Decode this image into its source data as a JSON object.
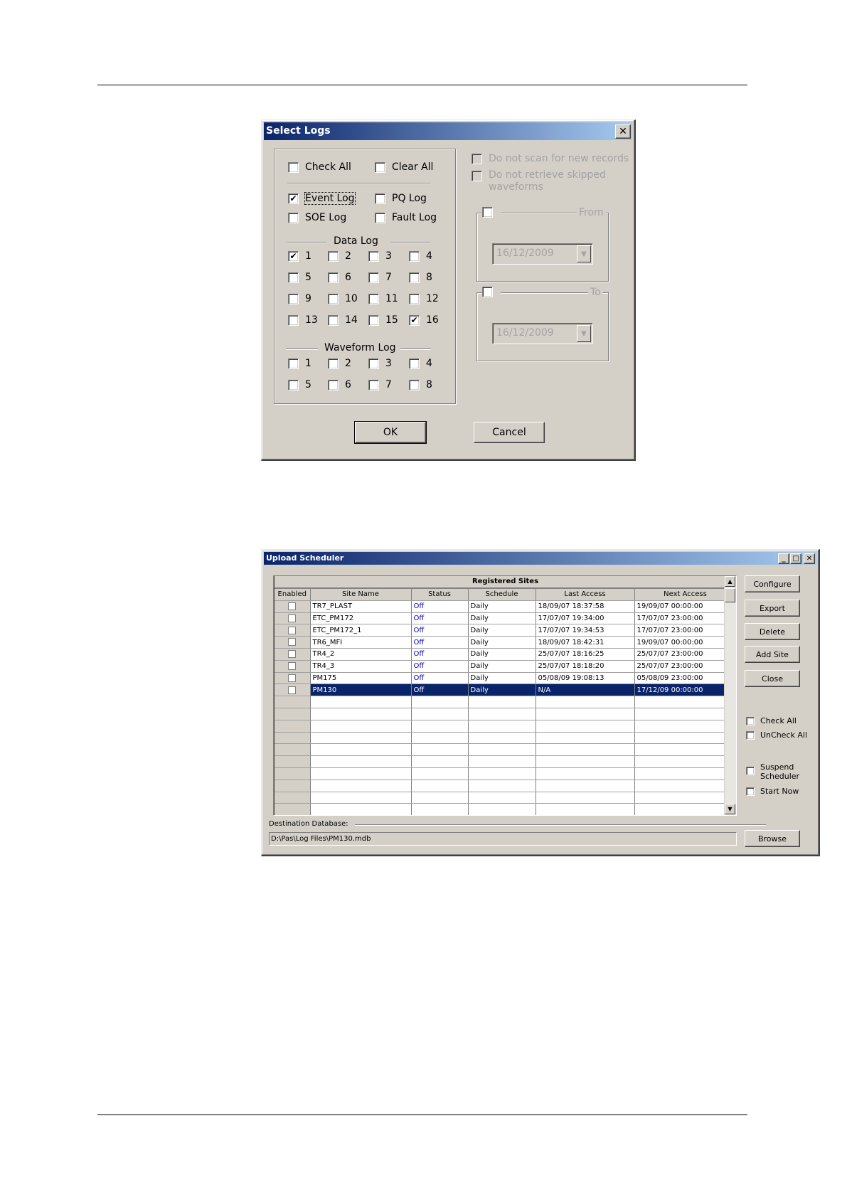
{
  "select_logs": {
    "title": "Select Logs",
    "close_glyph": "✕",
    "check_all": "Check All",
    "clear_all": "Clear All",
    "event_log": "Event Log",
    "pq_log": "PQ Log",
    "soe_log": "SOE Log",
    "fault_log": "Fault Log",
    "data_log_heading": "Data Log",
    "data_log_items": [
      "1",
      "2",
      "3",
      "4",
      "5",
      "6",
      "7",
      "8",
      "9",
      "10",
      "11",
      "12",
      "13",
      "14",
      "15",
      "16"
    ],
    "data_log_checked": [
      "1",
      "16"
    ],
    "waveform_log_heading": "Waveform Log",
    "waveform_items": [
      "1",
      "2",
      "3",
      "4",
      "5",
      "6",
      "7",
      "8"
    ],
    "no_scan": "Do not scan for new records",
    "no_retrieve_1": "Do not retrieve skipped",
    "no_retrieve_2": "waveforms",
    "from_label": "From",
    "from_date": "16/12/2009",
    "to_label": "To",
    "to_date": "16/12/2009",
    "ok": "OK",
    "cancel": "Cancel",
    "combo_arrow": "▼"
  },
  "upload_scheduler": {
    "title": "Upload Scheduler",
    "grid_title": "Registered Sites",
    "columns": [
      "Enabled",
      "Site Name",
      "Status",
      "Schedule",
      "Last Access",
      "Next Access"
    ],
    "rows": [
      {
        "site": "TR7_PLAST",
        "status": "Off",
        "schedule": "Daily",
        "last": "18/09/07 18:37:58",
        "next": "19/09/07 00:00:00"
      },
      {
        "site": "ETC_PM172",
        "status": "Off",
        "schedule": "Daily",
        "last": "17/07/07 19:34:00",
        "next": "17/07/07 23:00:00"
      },
      {
        "site": "ETC_PM172_1",
        "status": "Off",
        "schedule": "Daily",
        "last": "17/07/07 19:34:53",
        "next": "17/07/07 23:00:00"
      },
      {
        "site": "TR6_MFI",
        "status": "Off",
        "schedule": "Daily",
        "last": "18/09/07 18:42:31",
        "next": "19/09/07 00:00:00"
      },
      {
        "site": "TR4_2",
        "status": "Off",
        "schedule": "Daily",
        "last": "25/07/07 18:16:25",
        "next": "25/07/07 23:00:00"
      },
      {
        "site": "TR4_3",
        "status": "Off",
        "schedule": "Daily",
        "last": "25/07/07 18:18:20",
        "next": "25/07/07 23:00:00"
      },
      {
        "site": "PM175",
        "status": "Off",
        "schedule": "Daily",
        "last": "05/08/09 19:08:13",
        "next": "05/08/09 23:00:00"
      },
      {
        "site": "PM130",
        "status": "Off",
        "schedule": "Daily",
        "last": "N/A",
        "next": "17/12/09 00:00:00"
      }
    ],
    "selected_row": "PM130",
    "buttons": {
      "configure": "Configure",
      "export": "Export",
      "delete": "Delete",
      "add_site": "Add Site",
      "close": "Close",
      "browse": "Browse"
    },
    "check_all": "Check All",
    "uncheck_all": "UnCheck All",
    "suspend_1": "Suspend",
    "suspend_2": "Scheduler",
    "start_now": "Start Now",
    "dest_label": "Destination Database:",
    "dest_path": "D:\\Pas\\Log Files\\PM130.mdb",
    "window_glyphs": {
      "minimize": "_",
      "maximize": "□",
      "close": "✕"
    },
    "scroll_glyphs": {
      "up": "▲",
      "down": "▼"
    }
  }
}
